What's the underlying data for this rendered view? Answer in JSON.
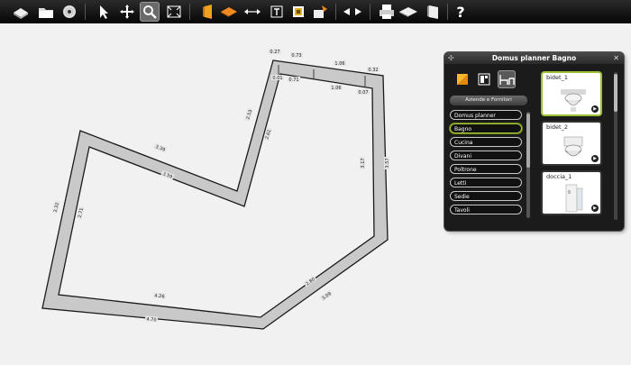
{
  "toolbar": {
    "tools": [
      "new-plan",
      "open-folder",
      "disc",
      "select-arrow",
      "pan-hand",
      "zoom",
      "fit-view",
      "door",
      "floor",
      "measure",
      "text",
      "image",
      "paint",
      "prev-next",
      "print",
      "3d-view",
      "export",
      "help"
    ],
    "active_tool": "zoom",
    "help_glyph": "?"
  },
  "plan": {
    "wall_fill": "#c9c9c9",
    "wall_stroke": "#1a1a1a",
    "dimensions": [
      "0.27",
      "0.73",
      "1.06",
      "0.32",
      "0.01",
      "0.71",
      "1.06",
      "0.07",
      "2.53",
      "2.61",
      "3.17",
      "3.57",
      "3.39",
      "3.59",
      "3.32",
      "2.71",
      "2.80",
      "3.09",
      "4.26",
      "4.70"
    ]
  },
  "panel": {
    "title": "Domus planner Bagno",
    "tabs": [
      "colors-icon",
      "layout-icon",
      "furniture-icon"
    ],
    "selected_tab": "furniture-icon",
    "section_button": "Aziende e Fornitori",
    "categories": [
      "Domus planner",
      "Bagno",
      "Cucina",
      "Divani",
      "Poltrone",
      "Letti",
      "Sedie",
      "Tavoli"
    ],
    "selected_category": "Bagno",
    "items": [
      {
        "label": "bidet_1",
        "selected": true
      },
      {
        "label": "bidet_2",
        "selected": false
      },
      {
        "label": "doccia_1",
        "selected": false
      }
    ],
    "accent": "#9ec036"
  }
}
